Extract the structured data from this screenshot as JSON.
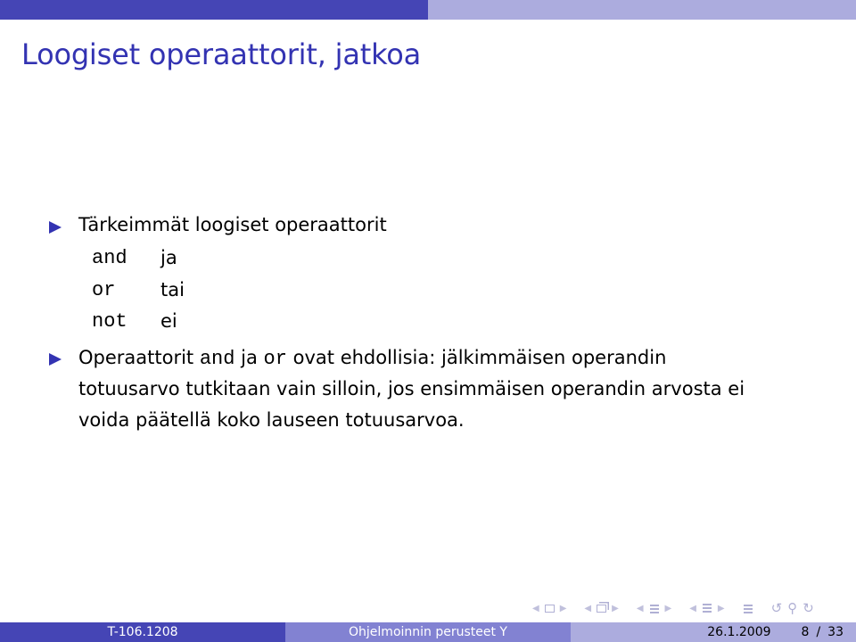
{
  "header": {
    "segments": [
      "",
      ""
    ]
  },
  "slide": {
    "title": "Loogiset operaattorit, jatkoa",
    "bullets": [
      {
        "text": "Tärkeimmät loogiset operaattorit",
        "operators": [
          {
            "code": "and",
            "meaning": "ja"
          },
          {
            "code": "or",
            "meaning": "tai"
          },
          {
            "code": "not",
            "meaning": "ei"
          }
        ]
      },
      {
        "line1_prefix": "Operaattorit",
        "line1_code1": "and",
        "line1_mid": "ja",
        "line1_code2": "or",
        "line1_suffix": "ovat ehdollisia: jälkimmäisen operandin",
        "line2": "totuusarvo tutkitaan vain silloin, jos ensimmäisen operandin arvosta ei",
        "line3": "voida päätellä koko lauseen totuusarvoa."
      }
    ]
  },
  "navigation": {
    "icons": [
      "frame-prev-icon",
      "frame-icon",
      "frame-next-icon",
      "subsection-prev-icon",
      "subsection-icon",
      "subsection-next-icon",
      "section-prev-icon",
      "section-icon",
      "section-next-icon",
      "document-prev-icon",
      "document-icon",
      "document-next-icon",
      "appendix-icon",
      "back-icon",
      "search-icon",
      "forward-icon"
    ]
  },
  "footer": {
    "course_code": "T-106.1208",
    "course_name": "Ohjelmoinnin perusteet Y",
    "date": "26.1.2009",
    "page_current": "8",
    "page_separator": "/",
    "page_total": "33"
  },
  "colors": {
    "theme_dark": "#4545b5",
    "theme_medium": "#8282d2",
    "theme_light": "#acacde",
    "title": "#3333b2"
  }
}
